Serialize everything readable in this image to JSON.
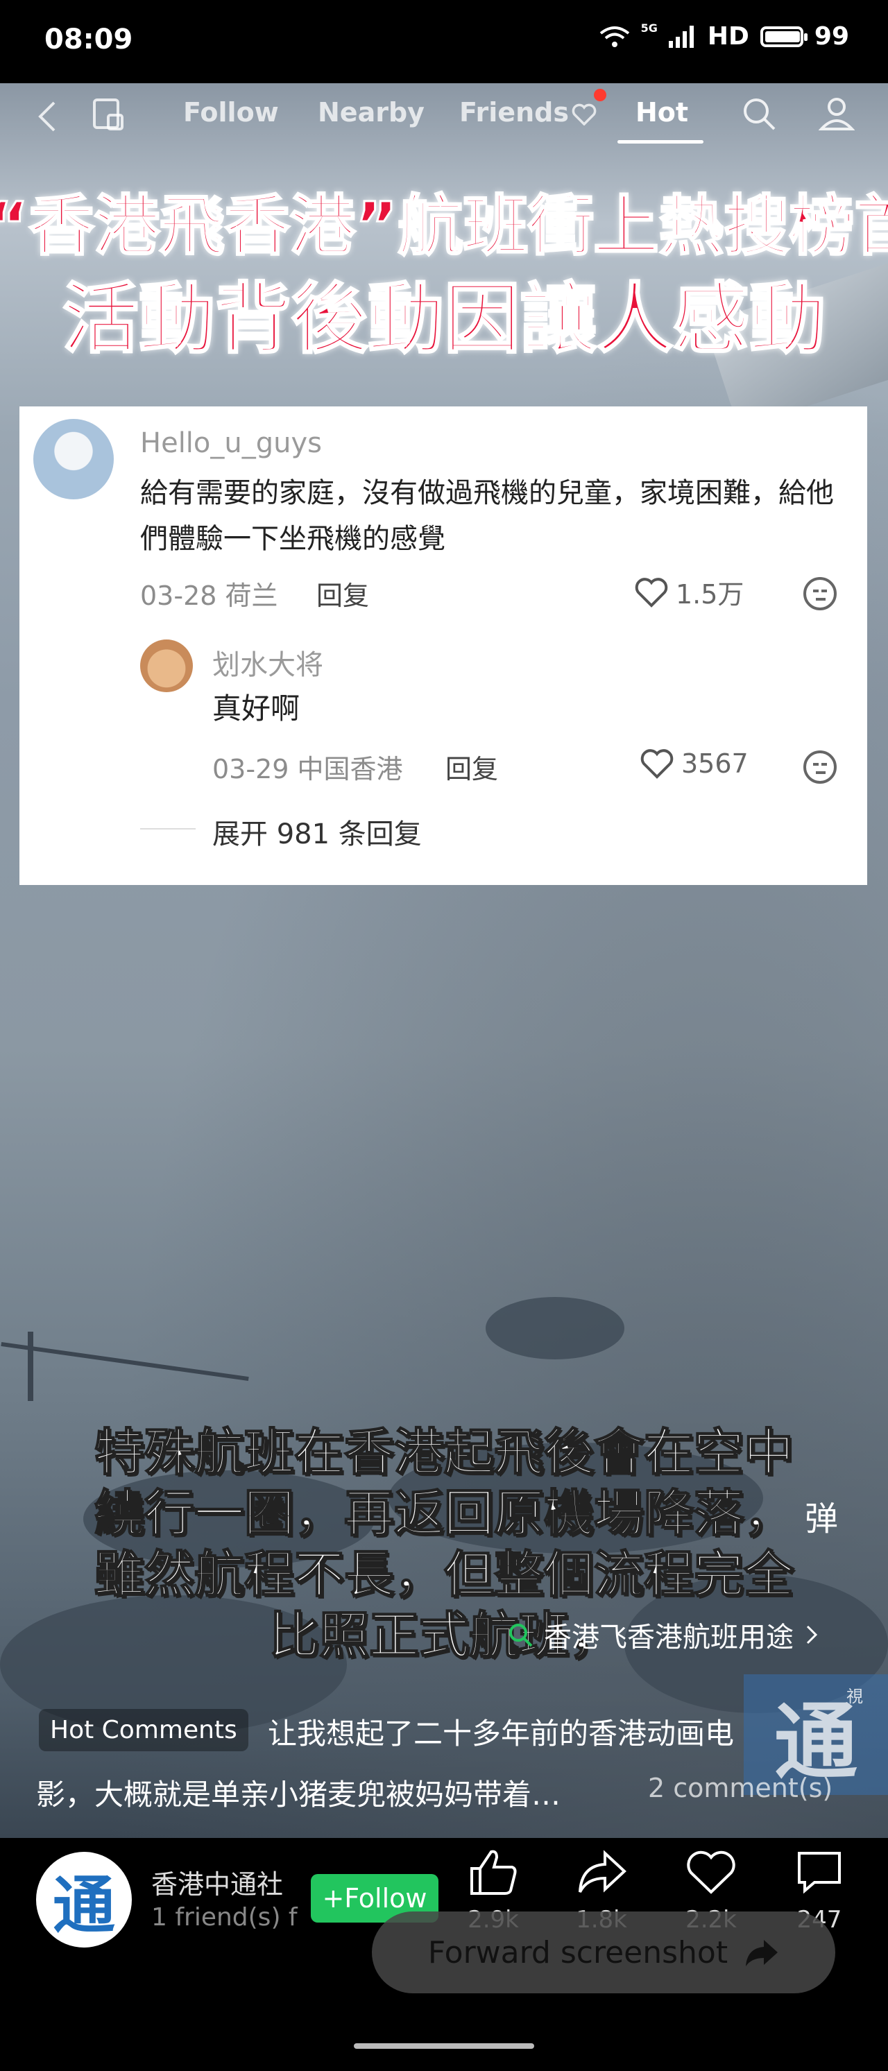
{
  "status_bar": {
    "time": "08:09",
    "network": "5G",
    "hd": "HD",
    "battery": "99",
    "battery_level": 0.99
  },
  "top_nav": {
    "tabs": [
      {
        "label": "Follow"
      },
      {
        "label": "Nearby"
      },
      {
        "label": "Friends"
      },
      {
        "label": "Hot"
      }
    ],
    "active_tab": "Hot"
  },
  "video": {
    "headline_line1": "“香港飛香港”航班衝上熱搜榜首",
    "headline_line2": "活動背後動因讓人感動",
    "subtitle_lines": [
      "特殊航班在香港起飛後會在空中",
      "繞行一圈，再返回原機場降落，",
      "雖然航程不長，但整個流程完全",
      "比照正式航班，"
    ],
    "danmu_label": "弹",
    "search_tag": "香港飞香港航班用途",
    "watermark_text": "通",
    "watermark_small": "視"
  },
  "comment_card": {
    "comment": {
      "username": "Hello_u_guys",
      "text": "給有需要的家庭，沒有做過飛機的兒童，家境困難，給他們體驗一下坐飛機的感覺",
      "date_location": "03-28 荷兰",
      "reply_label": "回复",
      "likes": "1.5万"
    },
    "reply": {
      "username": "划水大将",
      "text": "真好啊",
      "date_location": "03-29 中国香港",
      "reply_label": "回复",
      "likes": "3567"
    },
    "expand_label": "展开 981 条回复"
  },
  "hot_comments": {
    "badge": "Hot Comments",
    "text_line1": "让我想起了二十多年前的香港动画电",
    "text_line2": "影，大概就是单亲小猪麦兜被妈妈带着…",
    "count": "2 comment(s)"
  },
  "author": {
    "name": "香港中通社",
    "friends": "1 friend(s) f",
    "avatar_char": "通",
    "follow_label": "+Follow"
  },
  "actions": {
    "like_count": "2.9k",
    "share_count": "1.8k",
    "favorite_count": "2.2k",
    "comment_count": "247"
  },
  "forward_pill": {
    "label": "Forward screenshot"
  },
  "colors": {
    "follow_green": "#22c55e",
    "headline_red": "#e8123a",
    "nav_dot": "#ff3b30"
  }
}
